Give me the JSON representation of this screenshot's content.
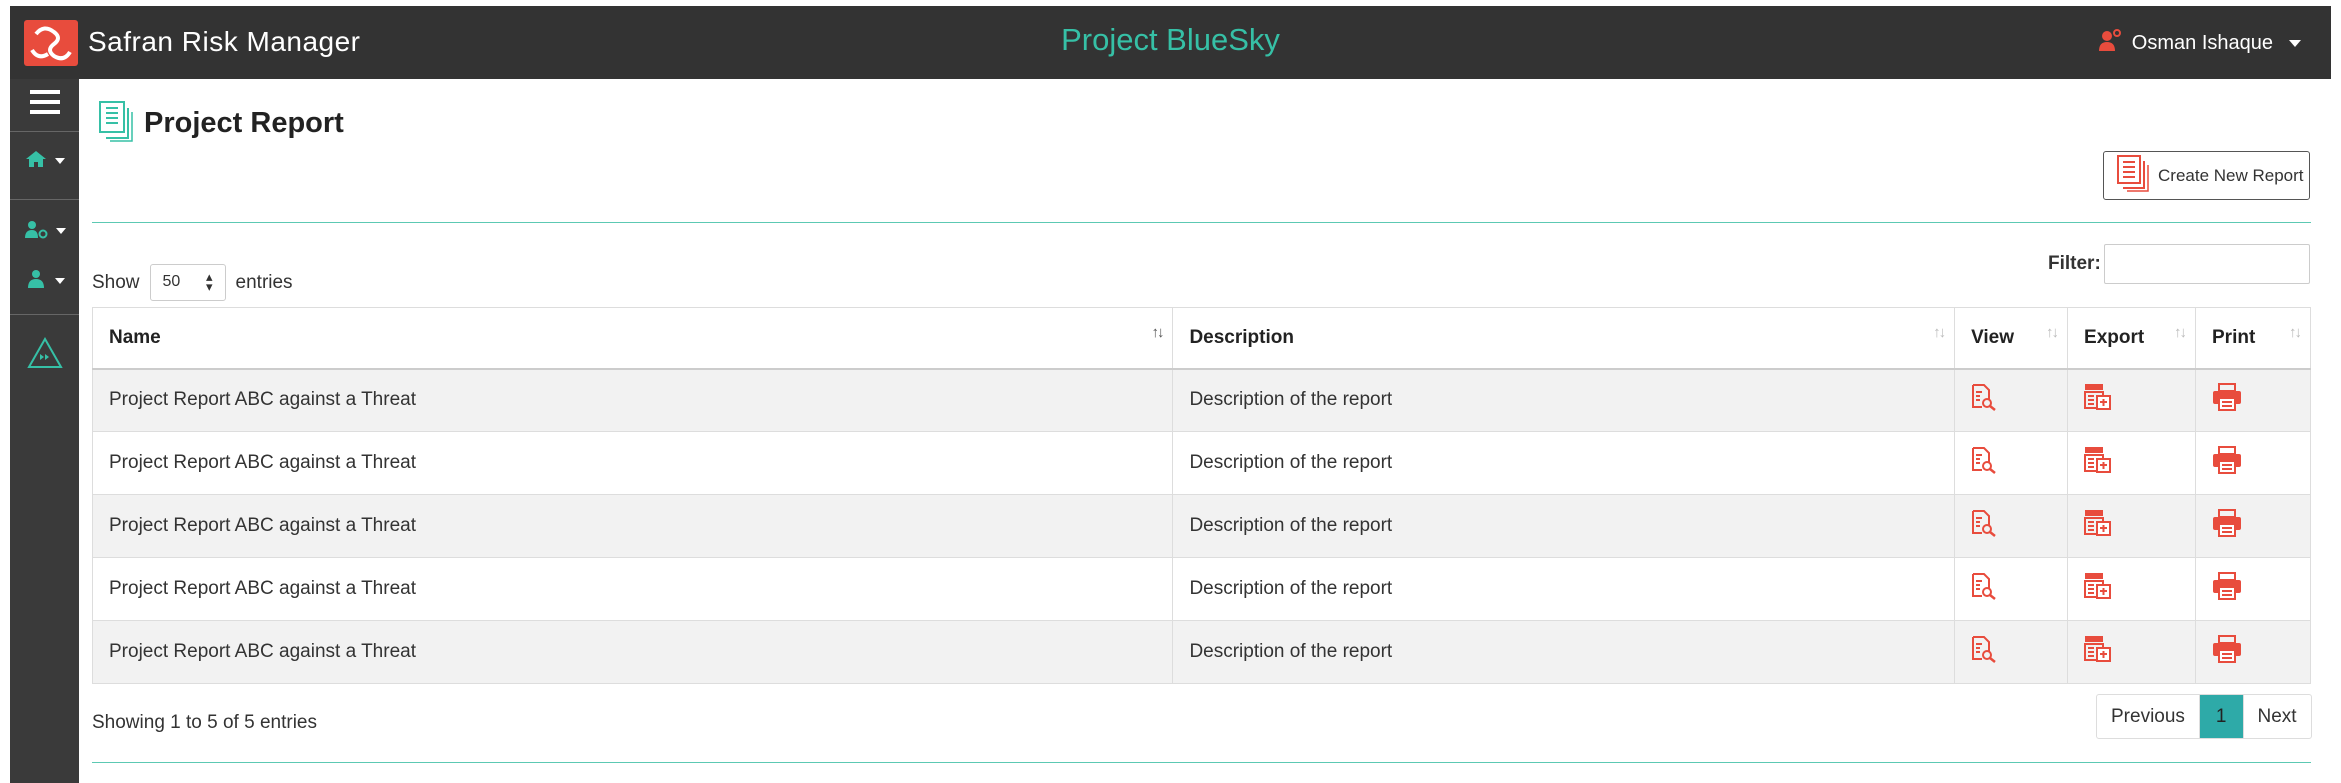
{
  "header": {
    "app_title": "Safran Risk Manager",
    "project_title": "Project BlueSky",
    "user_name": "Osman Ishaque"
  },
  "sidebar": {
    "items": [
      {
        "icon": "menu-icon"
      },
      {
        "icon": "home-icon"
      },
      {
        "icon": "user-settings-icon"
      },
      {
        "icon": "user-group-icon"
      },
      {
        "icon": "triangle-play-icon"
      }
    ]
  },
  "page": {
    "title": "Project Report",
    "create_button": "Create New Report"
  },
  "table_controls": {
    "show_label": "Show",
    "entries_value": "50",
    "entries_label": "entries",
    "filter_label": "Filter:"
  },
  "table": {
    "columns": [
      "Name",
      "Description",
      "View",
      "Export",
      "Print"
    ],
    "rows": [
      {
        "name": "Project Report ABC against a Threat",
        "description": "Description of the report"
      },
      {
        "name": "Project Report ABC against a Threat",
        "description": "Description of the report"
      },
      {
        "name": "Project Report ABC against a Threat",
        "description": "Description of the report"
      },
      {
        "name": "Project Report ABC against a Threat",
        "description": "Description of the report"
      },
      {
        "name": "Project Report ABC against a Threat",
        "description": "Description of the report"
      }
    ]
  },
  "footer": {
    "info": "Showing 1 to 5 of 5 entries",
    "previous": "Previous",
    "current_page": "1",
    "next": "Next"
  },
  "colors": {
    "accent": "#36c0a6",
    "icon_red": "#e84c3d",
    "topbar": "#333333",
    "sidebar": "#3a3a3a"
  }
}
